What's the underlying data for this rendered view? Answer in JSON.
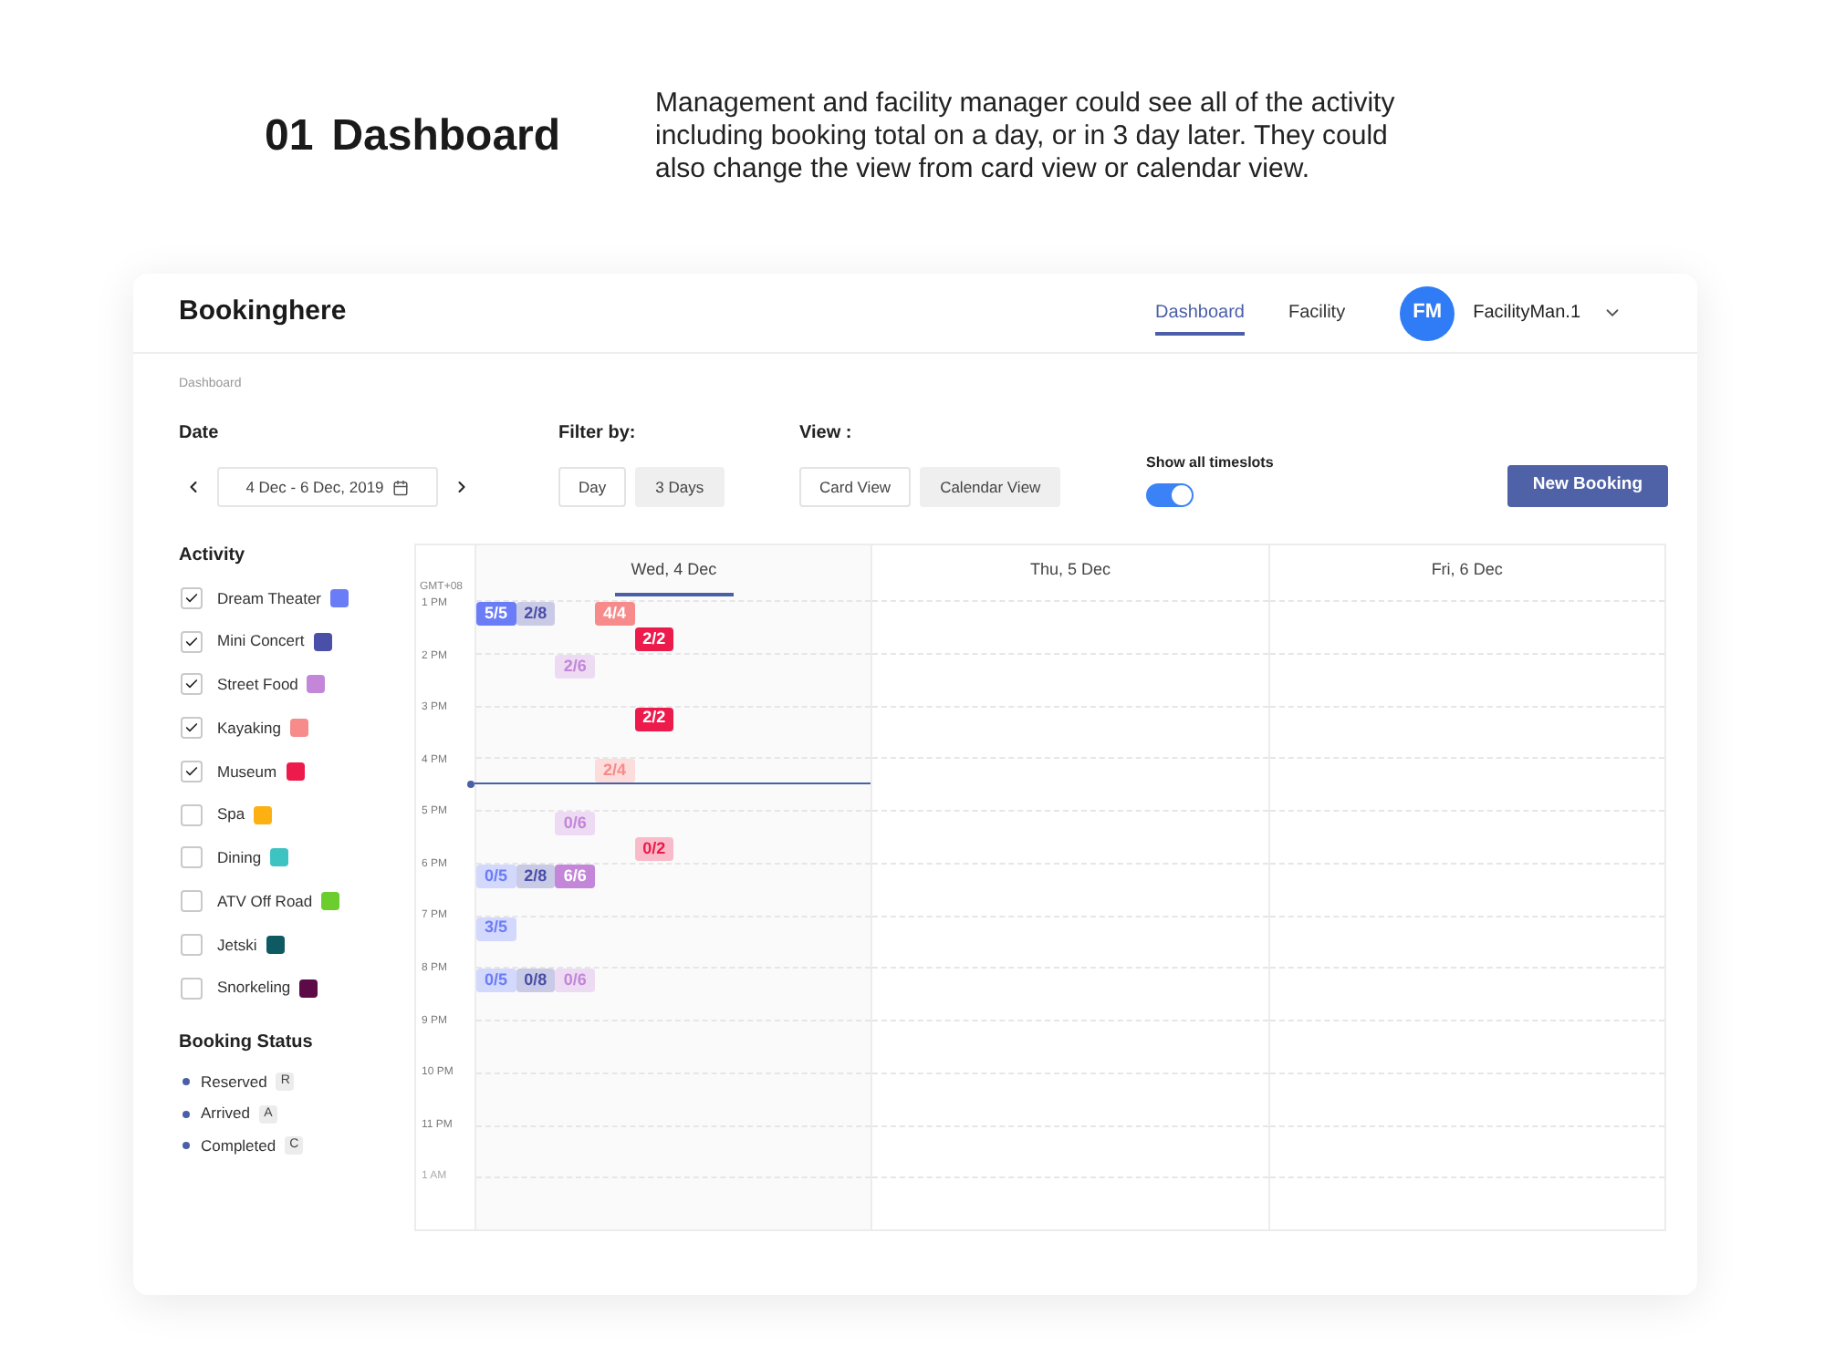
{
  "intro": {
    "number": "01",
    "title": "Dashboard",
    "description": "Management and facility manager could see all of the activity including booking total on a day, or in 3 day later. They could also change the view from card view or calendar view."
  },
  "header": {
    "brand": "Bookinghere",
    "nav": [
      {
        "label": "Dashboard",
        "selected": true
      },
      {
        "label": "Facility",
        "selected": false
      }
    ],
    "user": {
      "initials": "FM",
      "name": "FacilityMan.1"
    }
  },
  "breadcrumb": "Dashboard",
  "filters": {
    "date": {
      "label": "Date",
      "value": "4 Dec - 6 Dec, 2019"
    },
    "filter_by": {
      "label": "Filter by:",
      "options": [
        {
          "label": "Day",
          "selected": false
        },
        {
          "label": "3 Days",
          "selected": true
        }
      ]
    },
    "view": {
      "label": "View :",
      "options": [
        {
          "label": "Card View",
          "selected": false
        },
        {
          "label": "Calendar View",
          "selected": true
        }
      ]
    },
    "timeslots": {
      "label": "Show all timeslots",
      "on": true
    },
    "new_booking": "New Booking"
  },
  "activity": {
    "title": "Activity",
    "items": [
      {
        "name": "Dream Theater",
        "checked": true,
        "color": "#6b7cf7"
      },
      {
        "name": "Mini Concert",
        "checked": true,
        "color": "#4a4fa8"
      },
      {
        "name": "Street Food",
        "checked": true,
        "color": "#c386d8"
      },
      {
        "name": "Kayaking",
        "checked": true,
        "color": "#f78a8a"
      },
      {
        "name": "Museum",
        "checked": true,
        "color": "#ec1b4b"
      },
      {
        "name": "Spa",
        "checked": false,
        "color": "#fdb011"
      },
      {
        "name": "Dining",
        "checked": false,
        "color": "#3ec3c3"
      },
      {
        "name": "ATV Off Road",
        "checked": false,
        "color": "#6ccd2e"
      },
      {
        "name": "Jetski",
        "checked": false,
        "color": "#0e5a63"
      },
      {
        "name": "Snorkeling",
        "checked": false,
        "color": "#5c0b46"
      }
    ]
  },
  "booking_status": {
    "title": "Booking Status",
    "items": [
      {
        "label": "Reserved",
        "code": "R"
      },
      {
        "label": "Arrived",
        "code": "A"
      },
      {
        "label": "Completed",
        "code": "C"
      }
    ]
  },
  "calendar": {
    "timezone": "GMT+08",
    "hours": [
      {
        "label": "1 PM",
        "muted": false
      },
      {
        "label": "2 PM",
        "muted": false
      },
      {
        "label": "3 PM",
        "muted": false
      },
      {
        "label": "4 PM",
        "muted": false
      },
      {
        "label": "5 PM",
        "muted": false
      },
      {
        "label": "6 PM",
        "muted": false
      },
      {
        "label": "7 PM",
        "muted": false
      },
      {
        "label": "8 PM",
        "muted": false
      },
      {
        "label": "9 PM",
        "muted": false
      },
      {
        "label": "10 PM",
        "muted": false
      },
      {
        "label": "11 PM",
        "muted": false
      },
      {
        "label": "1 AM",
        "muted": true
      }
    ],
    "days": [
      {
        "label": "Wed, 4 Dec",
        "selected": true,
        "hour_blocks": [
          {
            "current_time": false,
            "events": [
              {
                "color": "#6b7cf7",
                "label": "5/5",
                "full": true,
                "second_half": false
              },
              {
                "color": "#4a4fa8",
                "label": "2/8",
                "full": false,
                "second_half": false
              },
              {
                "color": "#f78a8a",
                "label": "4/4",
                "full": true,
                "second_half": false
              },
              {
                "color": "#ec1b4b",
                "label": "2/2",
                "full": true,
                "second_half": true
              }
            ]
          },
          {
            "current_time": false,
            "events": [
              {
                "color": "#c386d8",
                "label": "2/6",
                "full": false,
                "second_half": false
              }
            ]
          },
          {
            "current_time": false,
            "events": [
              {
                "color": "#ec1b4b",
                "label": "2/2",
                "full": true,
                "second_half": false
              }
            ]
          },
          {
            "current_time": true,
            "events": [
              {
                "color": "#f78a8a",
                "label": "2/4",
                "full": false,
                "second_half": false
              }
            ]
          },
          {
            "current_time": false,
            "events": [
              {
                "color": "#c386d8",
                "label": "0/6",
                "full": false,
                "second_half": false
              },
              {
                "color": "#ec1b4b",
                "label": "0/2",
                "full": false,
                "second_half": true
              }
            ]
          },
          {
            "current_time": false,
            "events": [
              {
                "color": "#6b7cf7",
                "label": "0/5",
                "full": false,
                "second_half": false
              },
              {
                "color": "#4a4fa8",
                "label": "2/8",
                "full": false,
                "second_half": false
              },
              {
                "color": "#c386d8",
                "label": "6/6",
                "full": true,
                "second_half": false
              }
            ]
          },
          {
            "current_time": false,
            "events": [
              {
                "color": "#6b7cf7",
                "label": "3/5",
                "full": false,
                "second_half": false
              }
            ]
          },
          {
            "current_time": false,
            "events": [
              {
                "color": "#6b7cf7",
                "label": "0/5",
                "full": false,
                "second_half": false
              },
              {
                "color": "#4a4fa8",
                "label": "0/8",
                "full": false,
                "second_half": false
              },
              {
                "color": "#c386d8",
                "label": "0/6",
                "full": false,
                "second_half": false
              }
            ]
          }
        ]
      },
      {
        "label": "Thu, 5 Dec",
        "selected": false
      },
      {
        "label": "Fri, 6 Dec",
        "selected": false
      }
    ]
  }
}
